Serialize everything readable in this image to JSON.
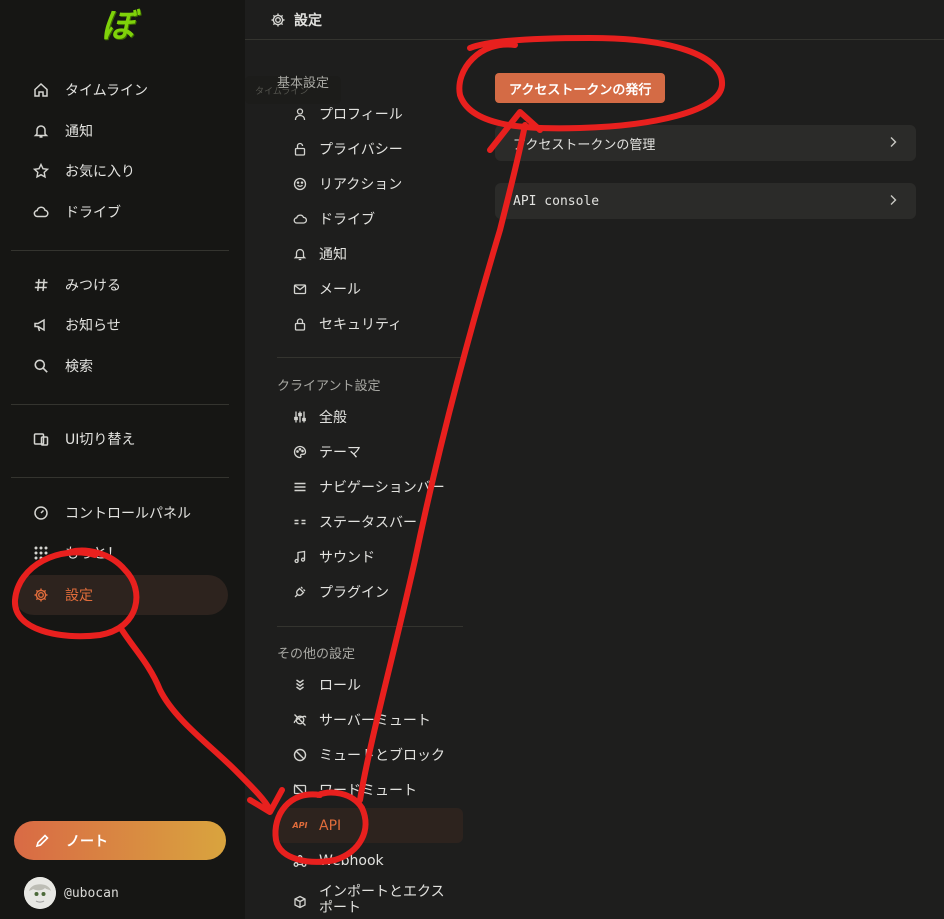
{
  "app": {
    "logo_text": "ぼ",
    "brand_color": "#7fd20a",
    "accent": "#e06c3b"
  },
  "nav": {
    "items": [
      {
        "label": "タイムライン",
        "icon": "home-icon"
      },
      {
        "label": "通知",
        "icon": "bell-icon"
      },
      {
        "label": "お気に入り",
        "icon": "star-icon"
      },
      {
        "label": "ドライブ",
        "icon": "cloud-icon"
      },
      {
        "label": "みつける",
        "icon": "hash-icon"
      },
      {
        "label": "お知らせ",
        "icon": "megaphone-icon"
      },
      {
        "label": "検索",
        "icon": "search-icon"
      },
      {
        "label": "UI切り替え",
        "icon": "devices-icon"
      },
      {
        "label": "コントロールパネル",
        "icon": "gauge-icon"
      },
      {
        "label": "もっと！",
        "icon": "dots-grid-icon"
      },
      {
        "label": "設定",
        "icon": "gear-icon",
        "active": true
      }
    ],
    "note_button": "ノート",
    "account": "@ubocan"
  },
  "header": {
    "title": "設定",
    "icon": "gear-icon"
  },
  "settings_menu": {
    "tooltip": "タイムライン",
    "sections": [
      {
        "label": "基本設定",
        "items": [
          "プロフィール",
          "プライバシー",
          "リアクション",
          "ドライブ",
          "通知",
          "メール",
          "セキュリティ"
        ]
      },
      {
        "label": "クライアント設定",
        "items": [
          "全般",
          "テーマ",
          "ナビゲーションバー",
          "ステータスバー",
          "サウンド",
          "プラグイン"
        ]
      },
      {
        "label": "その他の設定",
        "items": [
          "ロール",
          "サーバーミュート",
          "ミュートとブロック",
          "ワードミュート",
          "API",
          "Webhook",
          "インポートとエクスポート"
        ]
      }
    ],
    "active_item": "API",
    "api_icon_text": "API"
  },
  "content": {
    "issue_button": "アクセストークンの発行",
    "links": [
      "アクセストークンの管理",
      "API console"
    ]
  },
  "annotation_color": "#e8201e"
}
